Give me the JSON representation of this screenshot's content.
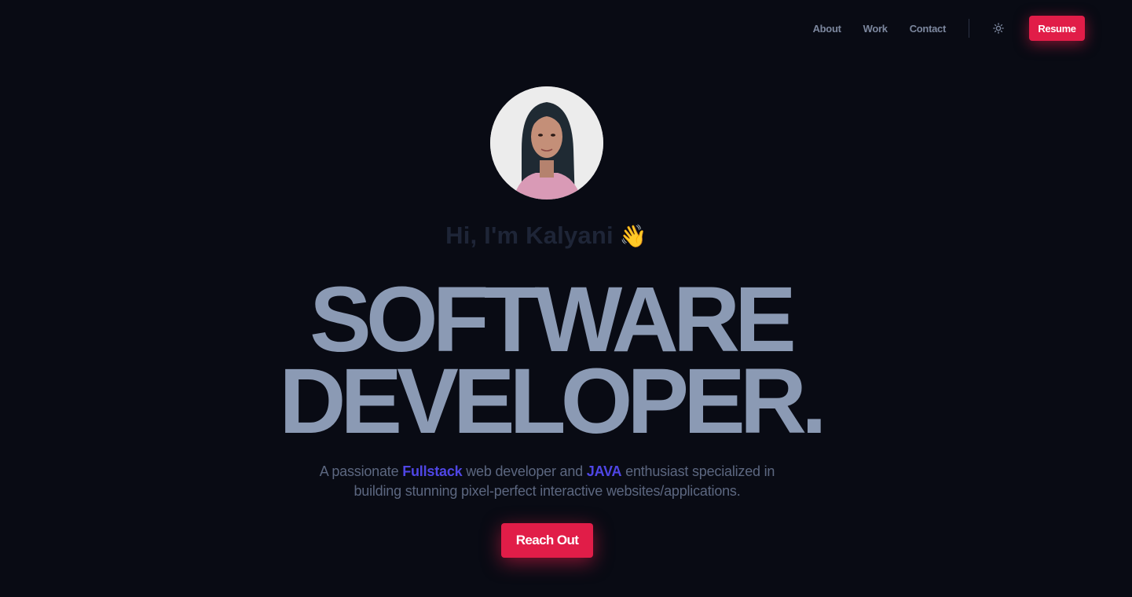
{
  "nav": {
    "links": [
      "About",
      "Work",
      "Contact"
    ],
    "theme_icon": "sun-icon",
    "resume_label": "Resume"
  },
  "hero": {
    "avatar_icon": "profile-photo",
    "greeting": "Hi, I'm Kalyani",
    "greeting_emoji": "👋",
    "headline_line1": "SOFTWARE",
    "headline_line2": "DEVELOPER.",
    "subtitle": {
      "part1": "A passionate ",
      "highlight1": "Fullstack",
      "part2": " web developer and ",
      "highlight2": "JAVA",
      "part3": " enthusiast specialized in",
      "line2": "building stunning pixel-perfect interactive websites/applications."
    },
    "cta_label": "Reach Out"
  },
  "colors": {
    "background": "#090b14",
    "accent": "#e11d48",
    "highlight": "#4f46e5",
    "headline": "#8b9ab4"
  }
}
